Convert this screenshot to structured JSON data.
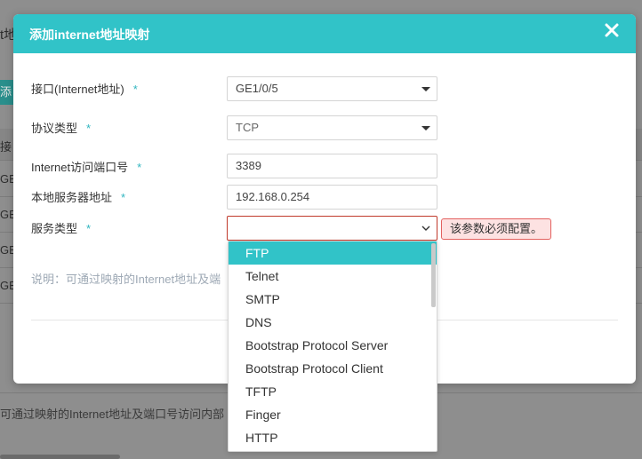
{
  "background": {
    "title_fragment": "t地",
    "add_button_fragment": "添",
    "header_fragment": "接",
    "rows": [
      "GE",
      "GE",
      "GE",
      "GE"
    ],
    "footer_text": "可通过映射的Internet地址及端口号访问内部"
  },
  "dialog": {
    "title": "添加internet地址映射",
    "close_label": "✕",
    "fields": {
      "interface": {
        "label": "接口(Internet地址)",
        "value": "GE1/0/5"
      },
      "protocol": {
        "label": "协议类型",
        "value": "TCP"
      },
      "internet_port": {
        "label": "Internet访问端口号",
        "value": "3389"
      },
      "local_server": {
        "label": "本地服务器地址",
        "value": "192.168.0.254"
      },
      "service_type": {
        "label": "服务类型",
        "value": ""
      }
    },
    "required_mark": "*",
    "error_message": "该参数必须配置。",
    "note": "说明：可通过映射的Internet地址及端"
  },
  "dropdown": {
    "options": [
      "FTP",
      "Telnet",
      "SMTP",
      "DNS",
      "Bootstrap Protocol Server",
      "Bootstrap Protocol Client",
      "TFTP",
      "Finger",
      "HTTP"
    ],
    "highlighted": "FTP"
  },
  "colors": {
    "accent": "#31c3c8",
    "required": "#31b6c0",
    "error_border": "#c0392b",
    "error_bg": "#fde2e2"
  }
}
